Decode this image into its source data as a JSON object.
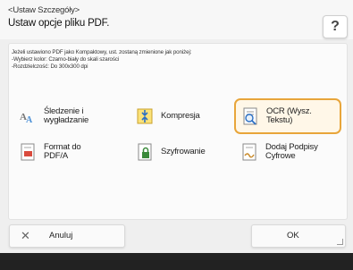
{
  "header": {
    "breadcrumb": "<Ustaw Szczegóły>",
    "title": "Ustaw opcje pliku PDF.",
    "help_label": "?"
  },
  "info": {
    "lines": [
      "Jeżeli ustawiono PDF jako Kompaktowy, ust. zostaną zmienione jak poniżej:",
      "-Wybierz kolor: Czarno-biały do skali szarości",
      "-Rozdzielczość: Do 300x300 dpi"
    ]
  },
  "options": [
    {
      "label": "Śledzenie i wygładzanie",
      "icon": "trace-smooth-icon",
      "selected": false
    },
    {
      "label": "Kompresja",
      "icon": "compression-icon",
      "selected": false
    },
    {
      "label": "OCR (Wysz. Tekstu)",
      "icon": "ocr-icon",
      "selected": true
    },
    {
      "label": "Format do PDF/A",
      "icon": "pdfa-icon",
      "selected": false
    },
    {
      "label": "Szyfrowanie",
      "icon": "encryption-icon",
      "selected": false
    },
    {
      "label": "Dodaj Podpisy Cyfrowe",
      "icon": "digital-signature-icon",
      "selected": false
    }
  ],
  "footer": {
    "cancel_label": "Anuluj",
    "ok_label": "OK"
  },
  "colors": {
    "selected_border": "#e8a53a",
    "background": "#efefef"
  }
}
